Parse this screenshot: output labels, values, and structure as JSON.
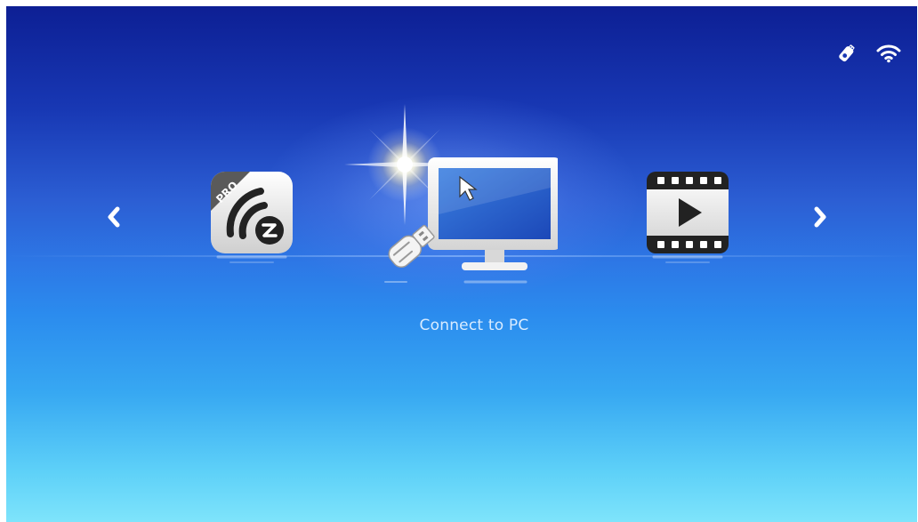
{
  "status_bar": {
    "usb_icon": "usb-stick-icon",
    "wifi_icon": "wifi-icon"
  },
  "carousel": {
    "prev_icon": "chevron-left-icon",
    "next_icon": "chevron-right-icon",
    "items": [
      {
        "id": "ezcast-pro",
        "icon": "ezcast-pro-icon",
        "badge": "PRO",
        "selected": false
      },
      {
        "id": "connect-to-pc",
        "icon": "monitor-usb-icon",
        "label": "Connect to PC",
        "selected": true
      },
      {
        "id": "video",
        "icon": "film-play-icon",
        "selected": false
      }
    ],
    "selected_label": "Connect to PC"
  },
  "colors": {
    "background_top": "#0d1f94",
    "background_bottom": "#7ee4fb",
    "icon_surface": "#f2f2f2",
    "icon_dark": "#2a2a2a",
    "label_text": "#d9ecff"
  }
}
